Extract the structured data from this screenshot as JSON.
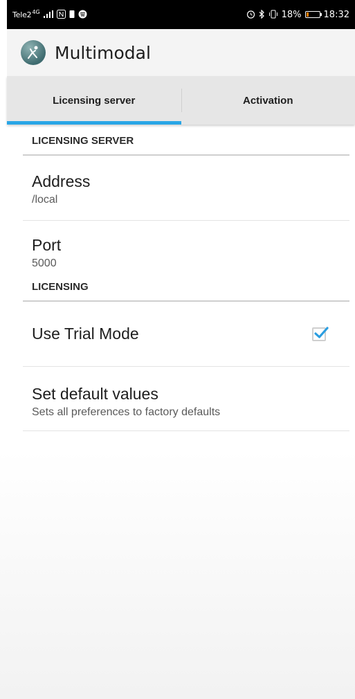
{
  "status_bar": {
    "carrier": "Tele2",
    "network": "4G",
    "battery_percent_label": "18%",
    "battery_level": 0.18,
    "time": "18:32"
  },
  "app": {
    "title": "Multimodal"
  },
  "tabs": [
    {
      "label": "Licensing server",
      "active": true
    },
    {
      "label": "Activation",
      "active": false
    }
  ],
  "sections": {
    "licensing_server": {
      "header": "LICENSING SERVER",
      "address": {
        "title": "Address",
        "value": "/local"
      },
      "port": {
        "title": "Port",
        "value": "5000"
      }
    },
    "licensing": {
      "header": "LICENSING",
      "trial_mode": {
        "title": "Use Trial Mode",
        "checked": true
      },
      "set_default": {
        "title": "Set default values",
        "summary": "Sets all preferences to factory defaults"
      }
    }
  },
  "colors": {
    "accent": "#29a6e6",
    "checkbox_check": "#2a9de0",
    "battery": "#f57c00"
  }
}
